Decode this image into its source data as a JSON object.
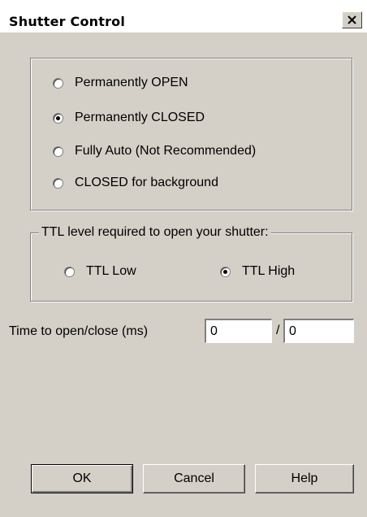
{
  "window": {
    "title": "Shutter Control",
    "close_glyph": "×"
  },
  "mode_group": {
    "options": [
      {
        "label": "Permanently OPEN",
        "selected": false
      },
      {
        "label": "Permanently CLOSED",
        "selected": true
      },
      {
        "label": "Fully Auto (Not Recommended)",
        "selected": false
      },
      {
        "label": "CLOSED for background",
        "selected": false
      }
    ]
  },
  "ttl_group": {
    "caption": "TTL level required to open your shutter:",
    "options": [
      {
        "label": "TTL Low",
        "selected": false
      },
      {
        "label": "TTL High",
        "selected": true
      }
    ]
  },
  "timing": {
    "label": "Time to open/close (ms)",
    "open_value": "0",
    "separator": "/",
    "close_value": "0"
  },
  "buttons": {
    "ok": "OK",
    "cancel": "Cancel",
    "help": "Help"
  },
  "colors": {
    "face": "#d4d0c8",
    "titlebar": "#ffffff"
  },
  "icons": {
    "close": "close-icon",
    "radio_selected": "radio-dot-icon"
  }
}
